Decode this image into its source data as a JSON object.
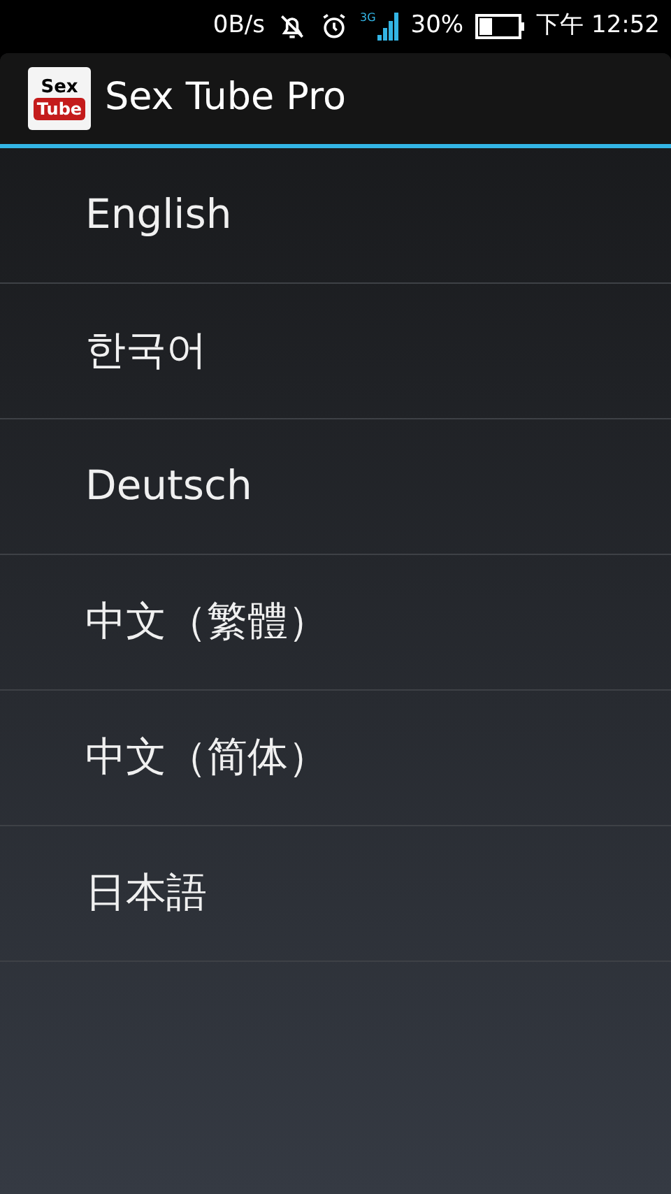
{
  "status_bar": {
    "net_speed": "0B/s",
    "network_type": "3G",
    "battery": "30%",
    "time": "下午 12:52"
  },
  "action_bar": {
    "icon_text": [
      "Sex",
      "Tube"
    ],
    "title": "Sex Tube Pro"
  },
  "languages": [
    {
      "label": "English"
    },
    {
      "label": "한국어"
    },
    {
      "label": "Deutsch"
    },
    {
      "label": "中文（繁體）"
    },
    {
      "label": "中文（简体）"
    },
    {
      "label": "日本語"
    }
  ]
}
